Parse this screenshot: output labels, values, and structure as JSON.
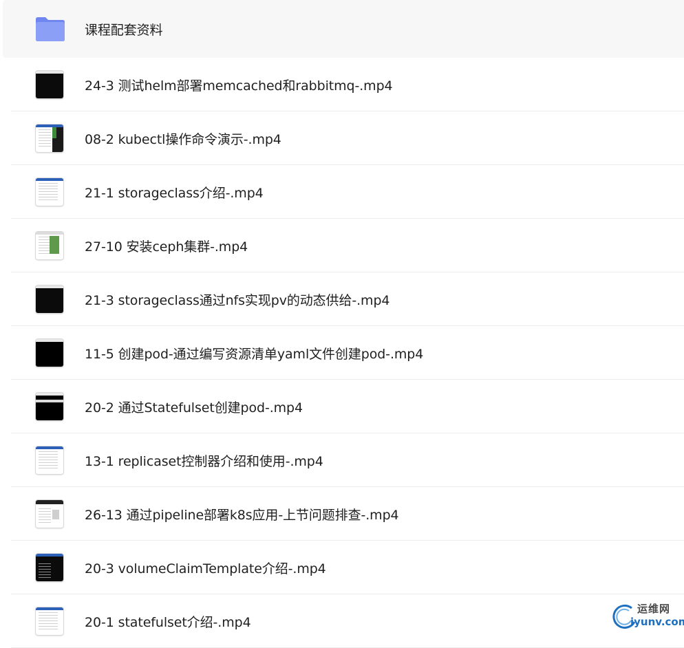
{
  "folder": {
    "name": "课程配套资料",
    "icon": "folder-icon",
    "color": "#7a8ff5"
  },
  "files": [
    {
      "name": "24-3 测试helm部署memcached和rabbitmq-.mp4",
      "thumb": "terminal"
    },
    {
      "name": "08-2 kubectl操作命令演示-.mp4",
      "thumb": "desktop"
    },
    {
      "name": "21-1 storageclass介绍-.mp4",
      "thumb": "document"
    },
    {
      "name": "27-10 安装ceph集群-.mp4",
      "thumb": "browser-green"
    },
    {
      "name": "21-3 storageclass通过nfs实现pv的动态供给-.mp4",
      "thumb": "terminal"
    },
    {
      "name": "11-5 创建pod-通过编写资源清单yaml文件创建pod-.mp4",
      "thumb": "terminal"
    },
    {
      "name": "20-2 通过Statefulset创建pod-.mp4",
      "thumb": "terminal-stripe"
    },
    {
      "name": "13-1 replicaset控制器介绍和使用-.mp4",
      "thumb": "document"
    },
    {
      "name": "26-13 通过pipeline部署k8s应用-上节问题排查-.mp4",
      "thumb": "jenkins"
    },
    {
      "name": "20-3 volumeClaimTemplate介绍-.mp4",
      "thumb": "terminal-text"
    },
    {
      "name": "20-1 statefulset介绍-.mp4",
      "thumb": "document"
    }
  ],
  "watermark": {
    "cn": "运维网",
    "en": "iyunv.com"
  }
}
